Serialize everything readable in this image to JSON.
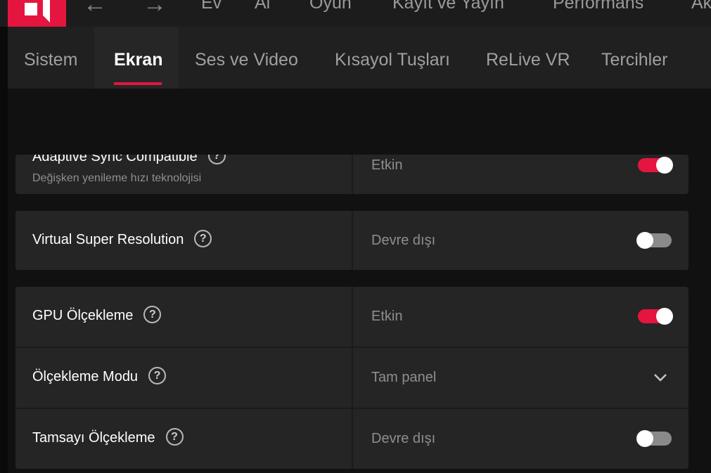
{
  "topnav": {
    "items": [
      "Ev",
      "Al",
      "Oyun",
      "Kayıt ve Yayın",
      "Performans",
      "Ak"
    ],
    "back_icon": "arrow-left-icon",
    "forward_icon": "arrow-right-icon",
    "logo": "amd-logo"
  },
  "subtabs": [
    "Sistem",
    "Ekran",
    "Ses ve Video",
    "Kısayol Tuşları",
    "ReLive VR",
    "Tercihler"
  ],
  "active_subtab": "Ekran",
  "settings": [
    {
      "label": "Adaptive Sync Compatible",
      "description": "Değişken yenileme hızı teknolojisi",
      "value": "Etkin",
      "control": "toggle",
      "enabled": true
    },
    {
      "label": "Virtual Super Resolution",
      "value": "Devre dışı",
      "control": "toggle",
      "enabled": false
    },
    {
      "label": "GPU Ölçekleme",
      "value": "Etkin",
      "control": "toggle",
      "enabled": true
    },
    {
      "label": "Ölçekleme Modu",
      "value": "Tam panel",
      "control": "dropdown"
    },
    {
      "label": "Tamsayı Ölçekleme",
      "value": "Devre dışı",
      "control": "toggle",
      "enabled": false
    }
  ],
  "colors": {
    "accent": "#e4163f",
    "background": "#111111",
    "card": "#252525"
  }
}
